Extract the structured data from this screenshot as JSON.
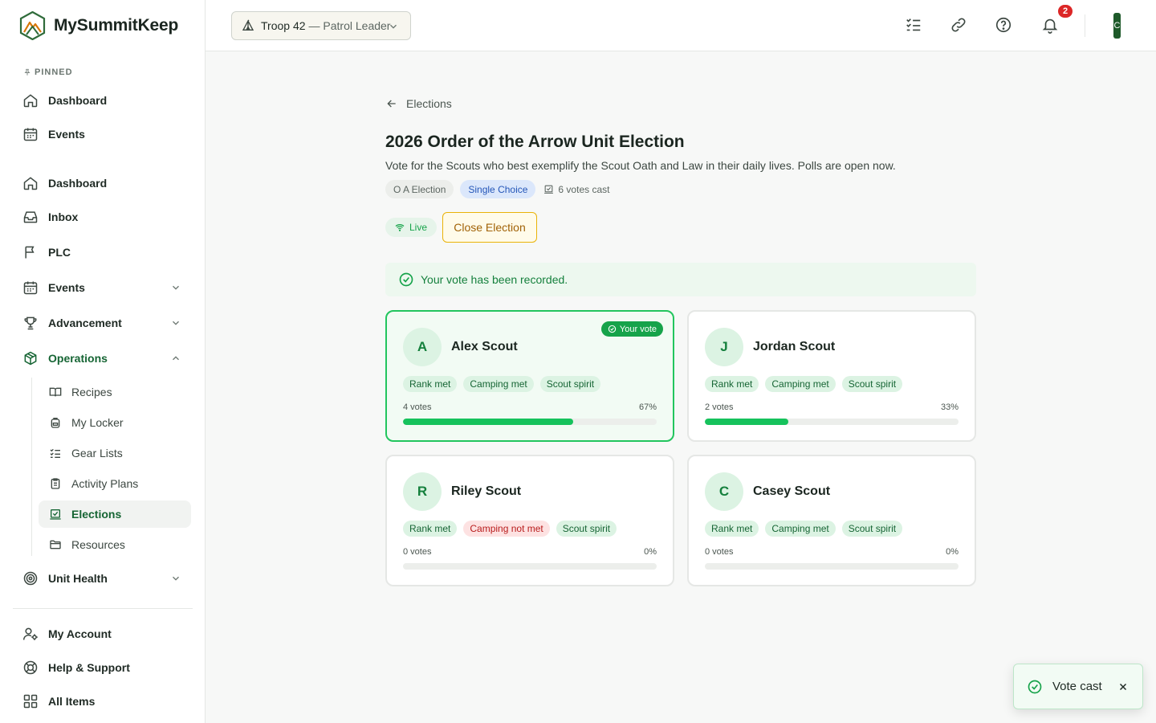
{
  "brand": {
    "name": "MySummitKeep"
  },
  "sidebar": {
    "pinned_label": "PINNED",
    "pinned": [
      {
        "label": "Dashboard",
        "icon": "home-icon"
      },
      {
        "label": "Events",
        "icon": "calendar-icon"
      }
    ],
    "items": [
      {
        "label": "Dashboard",
        "icon": "home-icon"
      },
      {
        "label": "Inbox",
        "icon": "inbox-icon"
      },
      {
        "label": "PLC",
        "icon": "flag-icon"
      },
      {
        "label": "Events",
        "icon": "calendar-icon",
        "expandable": true
      },
      {
        "label": "Advancement",
        "icon": "trophy-icon",
        "expandable": true
      },
      {
        "label": "Operations",
        "icon": "package-icon",
        "expanded": true
      },
      {
        "label": "Unit Health",
        "icon": "target-icon",
        "expandable": true
      }
    ],
    "operations_sub": [
      {
        "label": "Recipes",
        "icon": "book-icon"
      },
      {
        "label": "My Locker",
        "icon": "backpack-icon"
      },
      {
        "label": "Gear Lists",
        "icon": "checklist-icon"
      },
      {
        "label": "Activity Plans",
        "icon": "clipboard-icon"
      },
      {
        "label": "Elections",
        "icon": "ballot-icon",
        "active": true
      },
      {
        "label": "Resources",
        "icon": "folder-icon"
      }
    ],
    "footer": [
      {
        "label": "My Account",
        "icon": "user-settings-icon"
      },
      {
        "label": "Help & Support",
        "icon": "lifebuoy-icon"
      },
      {
        "label": "All Items",
        "icon": "grid-icon"
      }
    ]
  },
  "header": {
    "troop": "Troop 42",
    "role": "— Patrol Leader",
    "notification_count": "2",
    "avatar_initial": "C"
  },
  "page": {
    "back_label": "Elections",
    "title": "2026 Order of the Arrow Unit Election",
    "description": "Vote for the Scouts who best exemplify the Scout Oath and Law in their daily lives. Polls are open now.",
    "chip_type": "O A Election",
    "chip_mode": "Single Choice",
    "votes_cast": "6 votes cast",
    "status_label": "Live",
    "close_button": "Close Election",
    "alert_message": "Your vote has been recorded.",
    "your_vote_label": "Your vote"
  },
  "candidates": [
    {
      "initial": "A",
      "name": "Alex Scout",
      "selected": true,
      "tags": [
        {
          "label": "Rank met",
          "ok": true
        },
        {
          "label": "Camping met",
          "ok": true
        },
        {
          "label": "Scout spirit",
          "ok": true
        }
      ],
      "votes_label": "4 votes",
      "percent_label": "67%",
      "share": 0.67
    },
    {
      "initial": "J",
      "name": "Jordan Scout",
      "selected": false,
      "tags": [
        {
          "label": "Rank met",
          "ok": true
        },
        {
          "label": "Camping met",
          "ok": true
        },
        {
          "label": "Scout spirit",
          "ok": true
        }
      ],
      "votes_label": "2 votes",
      "percent_label": "33%",
      "share": 0.33
    },
    {
      "initial": "R",
      "name": "Riley Scout",
      "selected": false,
      "tags": [
        {
          "label": "Rank met",
          "ok": true
        },
        {
          "label": "Camping not met",
          "ok": false
        },
        {
          "label": "Scout spirit",
          "ok": true
        }
      ],
      "votes_label": "0 votes",
      "percent_label": "0%",
      "share": 0
    },
    {
      "initial": "C",
      "name": "Casey Scout",
      "selected": false,
      "tags": [
        {
          "label": "Rank met",
          "ok": true
        },
        {
          "label": "Camping met",
          "ok": true
        },
        {
          "label": "Scout spirit",
          "ok": true
        }
      ],
      "votes_label": "0 votes",
      "percent_label": "0%",
      "share": 0
    }
  ],
  "toast": {
    "message": "Vote cast"
  },
  "colors": {
    "accent": "#16a34a",
    "brand_dark": "#166534",
    "danger": "#dc2626",
    "warning": "#a16207"
  }
}
